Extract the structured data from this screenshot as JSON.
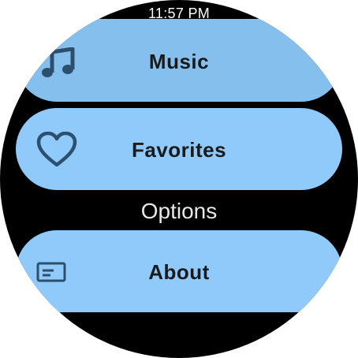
{
  "status": {
    "time": "11:57 PM"
  },
  "menu": {
    "items": [
      {
        "label": "Music",
        "icon": "music-note-icon"
      },
      {
        "label": "Favorites",
        "icon": "heart-icon"
      }
    ],
    "section_header": "Options",
    "options": [
      {
        "label": "About",
        "icon": "info-card-icon"
      }
    ]
  },
  "colors": {
    "background": "#000000",
    "chip": "#8fcafb",
    "chip_text": "#1a1a1a",
    "icon": "#2d4f6e"
  }
}
